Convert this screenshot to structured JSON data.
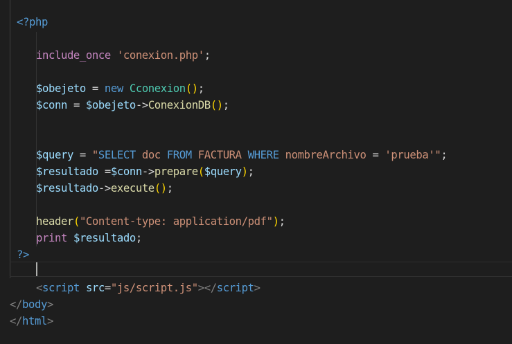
{
  "editor": {
    "lines": [
      {
        "indent": 24,
        "tokens": [
          {
            "t": "<?php",
            "c": "tag"
          }
        ]
      },
      {
        "indent": 0,
        "tokens": []
      },
      {
        "indent": 52,
        "tokens": [
          {
            "t": "include_once",
            "c": "kw"
          },
          {
            "t": " ",
            "c": "op"
          },
          {
            "t": "'conexion.php'",
            "c": "str"
          },
          {
            "t": ";",
            "c": "op"
          }
        ]
      },
      {
        "indent": 0,
        "tokens": []
      },
      {
        "indent": 52,
        "tokens": [
          {
            "t": "$obejeto",
            "c": "var"
          },
          {
            "t": " = ",
            "c": "op"
          },
          {
            "t": "new",
            "c": "new"
          },
          {
            "t": " ",
            "c": "op"
          },
          {
            "t": "Cconexion",
            "c": "cls"
          },
          {
            "t": "()",
            "c": "br"
          },
          {
            "t": ";",
            "c": "op"
          }
        ]
      },
      {
        "indent": 52,
        "tokens": [
          {
            "t": "$conn",
            "c": "var"
          },
          {
            "t": " = ",
            "c": "op"
          },
          {
            "t": "$obejeto",
            "c": "var"
          },
          {
            "t": "->",
            "c": "op"
          },
          {
            "t": "ConexionDB",
            "c": "fn"
          },
          {
            "t": "()",
            "c": "br"
          },
          {
            "t": ";",
            "c": "op"
          }
        ]
      },
      {
        "indent": 0,
        "tokens": []
      },
      {
        "indent": 0,
        "tokens": []
      },
      {
        "indent": 52,
        "tokens": [
          {
            "t": "$query",
            "c": "var"
          },
          {
            "t": " = ",
            "c": "op"
          },
          {
            "t": "\"",
            "c": "str"
          },
          {
            "t": "SELECT",
            "c": "sqlkw"
          },
          {
            "t": " doc ",
            "c": "str"
          },
          {
            "t": "FROM",
            "c": "sqlkw"
          },
          {
            "t": " FACTURA ",
            "c": "str"
          },
          {
            "t": "WHERE",
            "c": "sqlkw"
          },
          {
            "t": " nombreArchivo ",
            "c": "str"
          },
          {
            "t": "=",
            "c": "op"
          },
          {
            "t": " 'prueba'",
            "c": "str"
          },
          {
            "t": "\"",
            "c": "str"
          },
          {
            "t": ";",
            "c": "op"
          }
        ]
      },
      {
        "indent": 52,
        "tokens": [
          {
            "t": "$resultado",
            "c": "var"
          },
          {
            "t": " =",
            "c": "op"
          },
          {
            "t": "$conn",
            "c": "var"
          },
          {
            "t": "->",
            "c": "op"
          },
          {
            "t": "prepare",
            "c": "fn"
          },
          {
            "t": "(",
            "c": "br"
          },
          {
            "t": "$query",
            "c": "var"
          },
          {
            "t": ")",
            "c": "br"
          },
          {
            "t": ";",
            "c": "op"
          }
        ]
      },
      {
        "indent": 52,
        "tokens": [
          {
            "t": "$resultado",
            "c": "var"
          },
          {
            "t": "->",
            "c": "op"
          },
          {
            "t": "execute",
            "c": "fn"
          },
          {
            "t": "()",
            "c": "br"
          },
          {
            "t": ";",
            "c": "op"
          }
        ]
      },
      {
        "indent": 0,
        "tokens": []
      },
      {
        "indent": 52,
        "tokens": [
          {
            "t": "header",
            "c": "fn"
          },
          {
            "t": "(",
            "c": "br"
          },
          {
            "t": "\"Content-type: application/pdf\"",
            "c": "str"
          },
          {
            "t": ")",
            "c": "br"
          },
          {
            "t": ";",
            "c": "op"
          }
        ]
      },
      {
        "indent": 52,
        "tokens": [
          {
            "t": "print",
            "c": "kw"
          },
          {
            "t": " ",
            "c": "op"
          },
          {
            "t": "$resultado",
            "c": "var"
          },
          {
            "t": ";",
            "c": "op"
          }
        ]
      },
      {
        "indent": 24,
        "tokens": [
          {
            "t": "?>",
            "c": "tag"
          }
        ]
      },
      {
        "indent": 0,
        "tokens": []
      },
      {
        "indent": 52,
        "tokens": [
          {
            "t": "<",
            "c": "html"
          },
          {
            "t": "script",
            "c": "htag"
          },
          {
            "t": " ",
            "c": "op"
          },
          {
            "t": "src",
            "c": "attr"
          },
          {
            "t": "=",
            "c": "op"
          },
          {
            "t": "\"js/script.js\"",
            "c": "str"
          },
          {
            "t": "></",
            "c": "html"
          },
          {
            "t": "script",
            "c": "htag"
          },
          {
            "t": ">",
            "c": "html"
          }
        ]
      },
      {
        "indent": 14,
        "tokens": [
          {
            "t": "</",
            "c": "html"
          },
          {
            "t": "body",
            "c": "htag"
          },
          {
            "t": ">",
            "c": "html"
          }
        ]
      },
      {
        "indent": 14,
        "tokens": [
          {
            "t": "</",
            "c": "html"
          },
          {
            "t": "html",
            "c": "htag"
          },
          {
            "t": ">",
            "c": "html"
          }
        ]
      }
    ]
  },
  "theme": {
    "background": "#1e1e1e",
    "tag": "#569cd6",
    "keyword": "#c586c0",
    "string": "#ce9178",
    "variable": "#9cdcfe",
    "class": "#4ec9b0",
    "function": "#dcdcaa",
    "bracket": "#ffd700"
  }
}
